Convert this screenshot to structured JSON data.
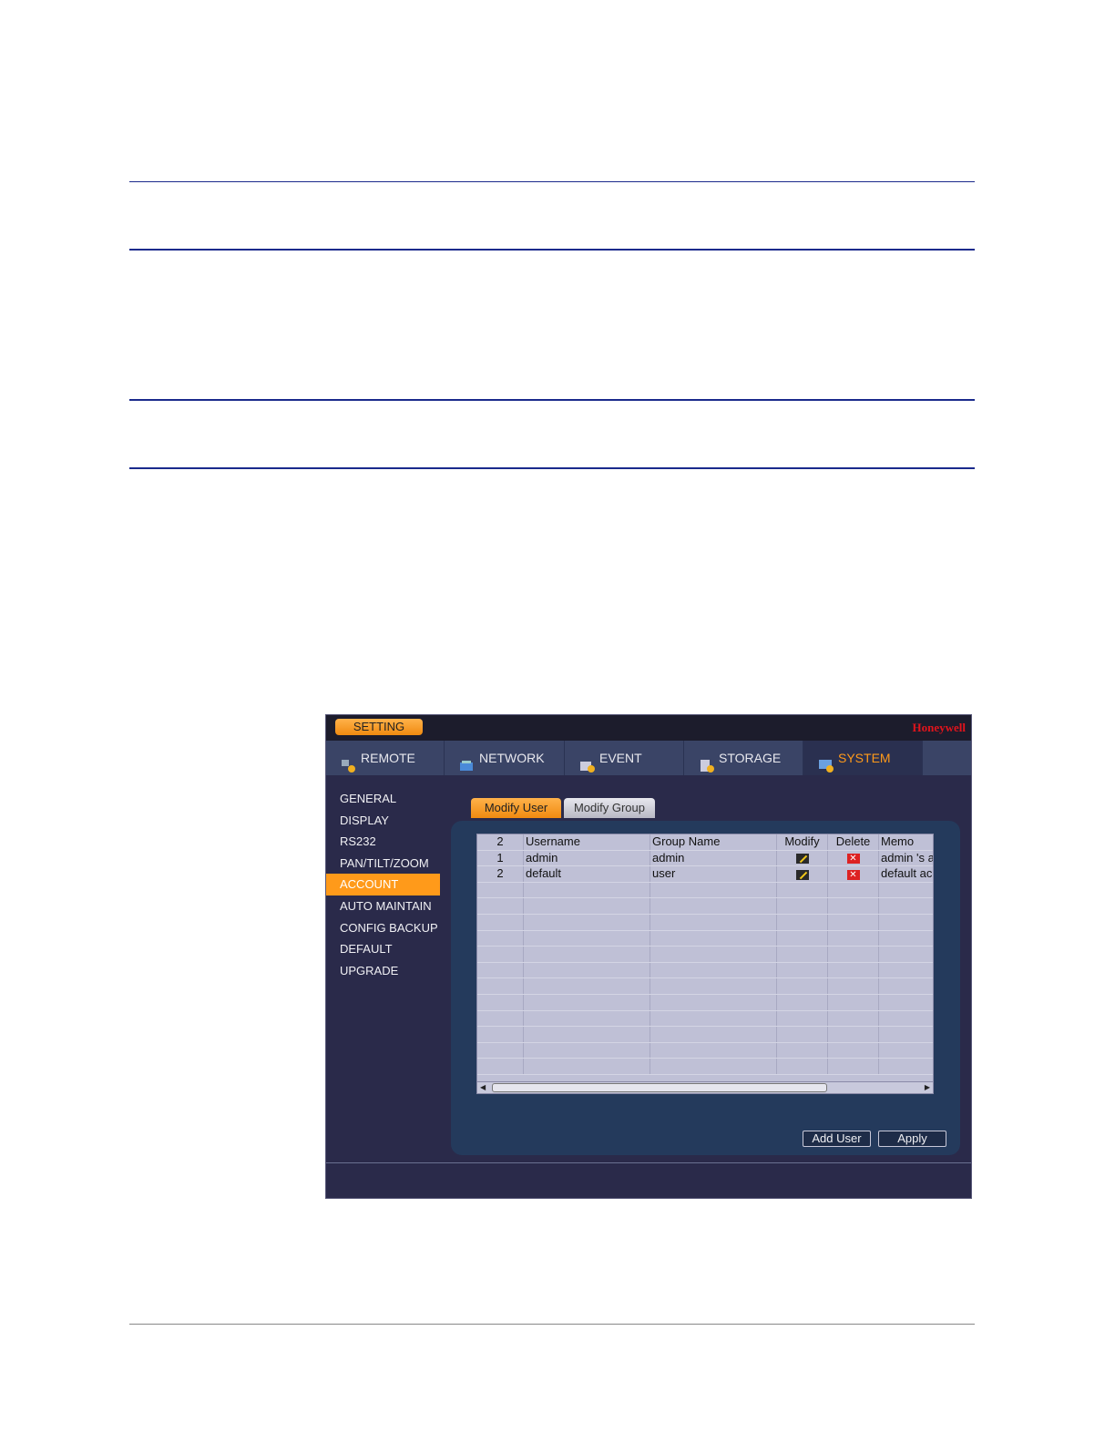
{
  "window": {
    "title_button": "SETTING",
    "brand": "Honeywell"
  },
  "top_tabs": [
    {
      "label": "REMOTE",
      "icon": "remote-icon"
    },
    {
      "label": "NETWORK",
      "icon": "network-icon"
    },
    {
      "label": "EVENT",
      "icon": "event-icon"
    },
    {
      "label": "STORAGE",
      "icon": "storage-icon"
    },
    {
      "label": "SYSTEM",
      "icon": "system-icon",
      "active": true
    }
  ],
  "sidebar": {
    "items": [
      "GENERAL",
      "DISPLAY",
      "RS232",
      "PAN/TILT/ZOOM",
      "ACCOUNT",
      "AUTO MAINTAIN",
      "CONFIG BACKUP",
      "DEFAULT",
      "UPGRADE"
    ],
    "active": "ACCOUNT"
  },
  "sub_tabs": [
    "Modify User",
    "Modify Group"
  ],
  "table": {
    "headers": [
      "2",
      "Username",
      "Group Name",
      "Modify",
      "Delete",
      "Memo"
    ],
    "rows": [
      {
        "index": "1",
        "username": "admin",
        "group": "admin",
        "memo": "admin 's a"
      },
      {
        "index": "2",
        "username": "default",
        "group": "user",
        "memo": "default acc"
      }
    ]
  },
  "buttons": {
    "add_user": "Add User",
    "apply": "Apply"
  },
  "colors": {
    "accent": "#ff9a1a",
    "brand": "#e1141c",
    "window_bg": "#2a2a4a",
    "table_bg": "#bfc0d6"
  }
}
